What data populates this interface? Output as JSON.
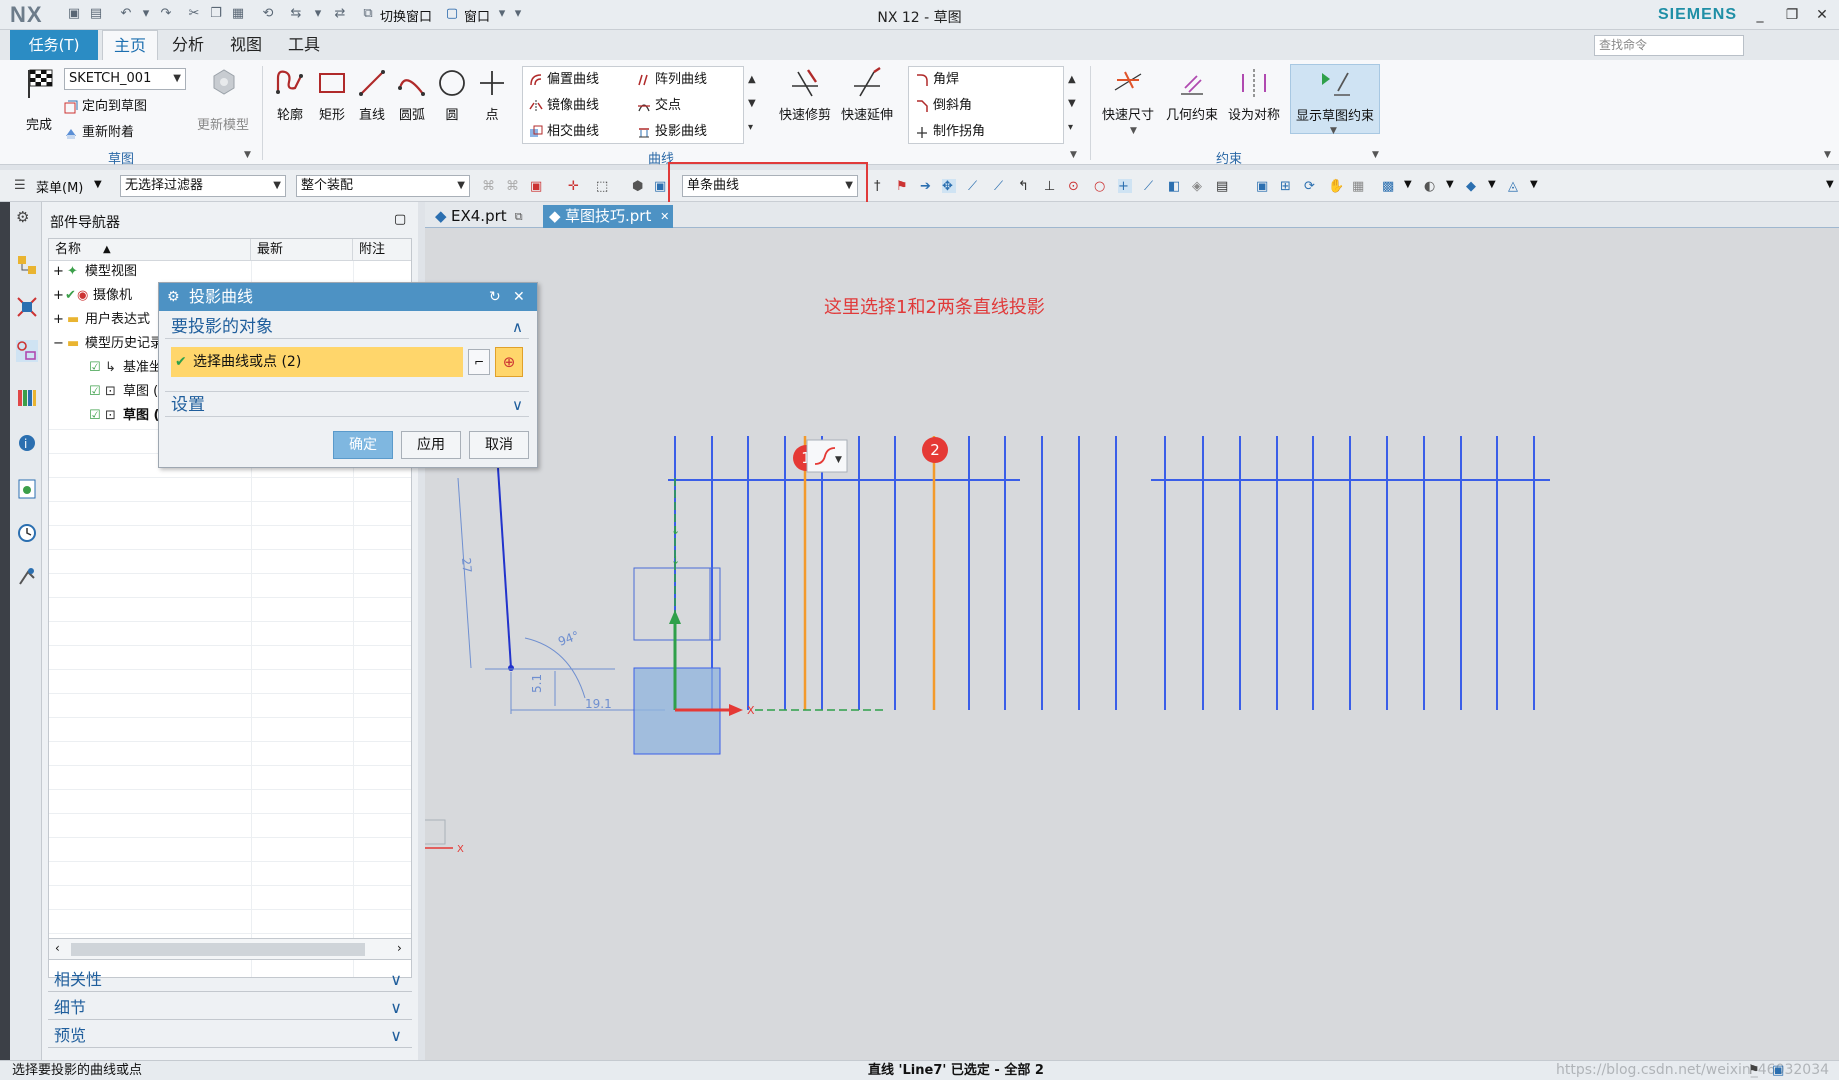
{
  "window": {
    "logo": "NX",
    "title": "NX 12 - 草图",
    "brand": "SIEMENS",
    "switch_window": "切换窗口",
    "window_menu": "窗口"
  },
  "tabs": {
    "task": "任务(T)",
    "items": [
      "主页",
      "分析",
      "视图",
      "工具"
    ],
    "active": "主页",
    "search_placeholder": "查找命令"
  },
  "ribbon": {
    "sketch_group": {
      "finish": "完成",
      "sketch_name": "SKETCH_001",
      "orient": "定向到草图",
      "reattach": "重新附着",
      "update_model": "更新模型",
      "label": "草图"
    },
    "curve_group": {
      "profile": "轮廓",
      "rectangle": "矩形",
      "line": "直线",
      "arc": "圆弧",
      "circle": "圆",
      "point": "点",
      "offset": "偏置曲线",
      "pattern": "阵列曲线",
      "mirror": "镜像曲线",
      "intersection": "交点",
      "intersect_curve": "相交曲线",
      "project": "投影曲线",
      "quick_trim": "快速修剪",
      "quick_extend": "快速延伸",
      "fillet": "角焊",
      "chamfer": "倒斜角",
      "corner": "制作拐角",
      "label": "曲线"
    },
    "constraint_group": {
      "rapid_dim": "快速尺寸",
      "geo_constraint": "几何约束",
      "make_symmetric": "设为对称",
      "show_constraints": "显示草图约束",
      "label": "约束"
    }
  },
  "toolbar2": {
    "menu": "菜单(M)",
    "filter": "无选择过滤器",
    "assembly": "整个装配",
    "curve_rule": "单条曲线"
  },
  "navigator": {
    "title": "部件导航器",
    "columns": [
      "名称",
      "最新",
      "附注"
    ],
    "rows": [
      {
        "label": "模型视图",
        "indent": 0,
        "expander": "+"
      },
      {
        "label": "摄像机",
        "indent": 0,
        "expander": "+"
      },
      {
        "label": "用户表达式",
        "indent": 0,
        "expander": "+"
      },
      {
        "label": "模型历史记录",
        "indent": 0,
        "expander": "−"
      },
      {
        "label": "基准坐标系",
        "indent": 1,
        "expander": ""
      },
      {
        "label": "草图 (1)",
        "indent": 1,
        "expander": ""
      },
      {
        "label": "草图 (2)",
        "indent": 1,
        "expander": ""
      }
    ],
    "panels": [
      "相关性",
      "细节",
      "预览"
    ]
  },
  "dialog": {
    "title": "投影曲线",
    "section_objects": "要投影的对象",
    "select_label": "选择曲线或点 (2)",
    "section_settings": "设置",
    "ok": "确定",
    "apply": "应用",
    "cancel": "取消"
  },
  "doc_tabs": [
    "EX4.prt",
    "草图技巧.prt"
  ],
  "active_doc": "草图技巧.prt",
  "annotation": "这里选择1和2两条直线投影",
  "markers": [
    "1",
    "2"
  ],
  "dimensions": [
    "94°",
    "27",
    "5.1",
    "19.1"
  ],
  "status": {
    "left": "选择要投影的曲线或点",
    "center": "直线 'Line7' 已选定 - 全部 2",
    "watermark": "https://blog.csdn.net/weixin_46032034"
  },
  "colors": {
    "accent": "#2b8cc4",
    "selected_curve": "#f39a2b",
    "sketch_curve": "#3a5ee8",
    "annotation": "#e03a3a",
    "highlight_box": "#e03a3a"
  }
}
